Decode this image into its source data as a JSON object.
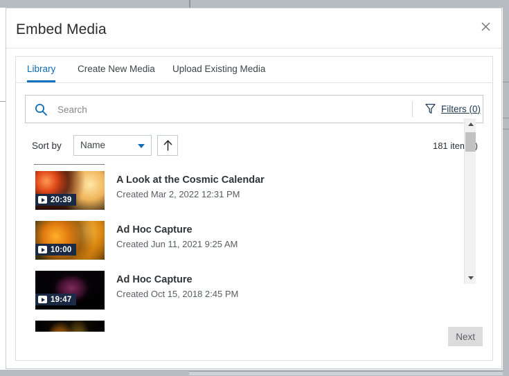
{
  "dialog": {
    "title": "Embed Media",
    "close_icon": "close-icon"
  },
  "tabs": [
    {
      "label": "Library",
      "active": true
    },
    {
      "label": "Create New Media",
      "active": false
    },
    {
      "label": "Upload Existing Media",
      "active": false
    }
  ],
  "search": {
    "placeholder": "Search",
    "value": "",
    "icon": "search-icon",
    "filters_label": "Filters (0)",
    "filters_icon": "funnel-icon"
  },
  "sort": {
    "label": "Sort by",
    "selected": "Name",
    "options": [
      "Name"
    ],
    "direction_icon": "arrow-up-icon",
    "item_count": "181 item(s)"
  },
  "media_items": [
    {
      "title": "A Look at the Cosmic Calendar",
      "created": "Created Mar 2, 2022 12:31 PM",
      "duration": "20:39",
      "thumb_class": "thumb-1"
    },
    {
      "title": "Ad Hoc Capture",
      "created": "Created Jun 11, 2021 9:25 AM",
      "duration": "10:00",
      "thumb_class": "thumb-2"
    },
    {
      "title": "Ad Hoc Capture",
      "created": "Created Oct 15, 2018 2:45 PM",
      "duration": "19:47",
      "thumb_class": "thumb-3"
    },
    {
      "title": "",
      "created": "",
      "duration": "",
      "thumb_class": "thumb-4"
    }
  ],
  "footer": {
    "next_label": "Next"
  },
  "colors": {
    "accent": "#1173bd",
    "link": "#223a52",
    "badge_bg": "#1b2a44",
    "button_bg": "#dcdcdc",
    "page_bg": "#b6bcc2"
  }
}
